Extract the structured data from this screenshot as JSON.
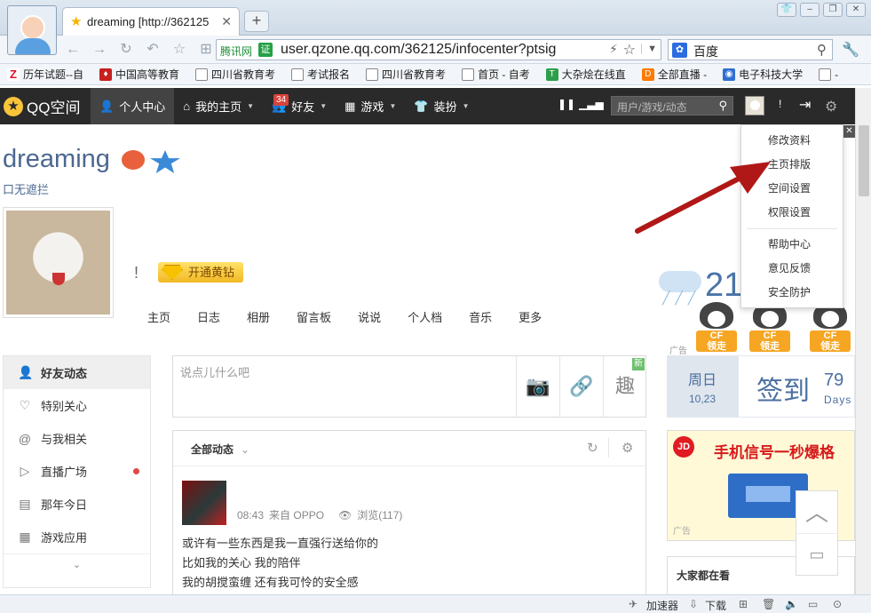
{
  "browser": {
    "tab_title": "dreaming [http://362125",
    "address": {
      "site_label": "腾讯网",
      "cert_label": "证",
      "url": "user.qzone.qq.com/362125/infocenter?ptsig"
    },
    "search": {
      "engine": "百度"
    },
    "bookmarks": [
      {
        "label": "历年试题--自",
        "icon": "z-icon"
      },
      {
        "label": "中国高等教育",
        "icon": "red-icon"
      },
      {
        "label": "四川省教育考",
        "icon": "doc-icon"
      },
      {
        "label": "考试报名",
        "icon": "doc-icon"
      },
      {
        "label": "四川省教育考",
        "icon": "doc-icon"
      },
      {
        "label": "首页 - 自考",
        "icon": "doc-icon"
      },
      {
        "label": "大杂烩在线直",
        "icon": "green-icon"
      },
      {
        "label": "全部直播 -",
        "icon": "orange-icon"
      },
      {
        "label": "电子科技大学",
        "icon": "blue-icon"
      },
      {
        "label": "-",
        "icon": "doc-icon"
      }
    ],
    "status": {
      "accelerator": "加速器",
      "download": "下载"
    }
  },
  "qzone_bar": {
    "logo": "QQ空间",
    "nav": [
      {
        "label": "个人中心",
        "active": true
      },
      {
        "label": "我的主页",
        "caret": true
      },
      {
        "label": "好友",
        "caret": true,
        "badge": "34"
      },
      {
        "label": "游戏",
        "caret": true
      },
      {
        "label": "装扮",
        "caret": true
      }
    ],
    "search_placeholder": "用户/游戏/动态",
    "exclaim": "!"
  },
  "profile": {
    "name": "dreaming",
    "signature": "口无遮拦",
    "exclaim": "!",
    "vip_button": "开通黄钻",
    "nav": [
      "主页",
      "日志",
      "相册",
      "留言板",
      "说说",
      "个人档",
      "音乐",
      "更多"
    ]
  },
  "weather": {
    "temp": "21",
    "ad_tag": "广告"
  },
  "dogs": [
    {
      "line1": "CF",
      "line2": "领走"
    },
    {
      "line1": "CF",
      "line2": "领走"
    },
    {
      "line1": "CF",
      "line2": "领走"
    }
  ],
  "left_menu": {
    "items": [
      {
        "label": "好友动态",
        "icon": "user-icon",
        "active": true
      },
      {
        "label": "特别关心",
        "icon": "heart-icon"
      },
      {
        "label": "与我相关",
        "icon": "at-icon"
      },
      {
        "label": "直播广场",
        "icon": "play-icon",
        "dot": true
      },
      {
        "label": "那年今日",
        "icon": "calendar-icon"
      },
      {
        "label": "游戏应用",
        "icon": "grid-icon"
      }
    ]
  },
  "composer": {
    "placeholder": "说点儿什么吧",
    "new_badge": "新",
    "fun_label": "趣"
  },
  "feed": {
    "filter": "全部动态",
    "post": {
      "name": "",
      "time": "08:43",
      "source": "来自 OPPO",
      "views": "浏览(117)",
      "lines": [
        "或许有一些东西是我一直强行送给你的",
        "比如我的关心 我的陪伴",
        "我的胡搅蛮缠 还有我可怜的安全感"
      ]
    }
  },
  "checkin": {
    "day_of_week": "周日",
    "date": "10,23",
    "label": "签到",
    "count": "79",
    "unit": "Days"
  },
  "ad": {
    "brand": "JD",
    "headline": "手机信号一秒爆格",
    "tag": "广告"
  },
  "hot": {
    "title": "大家都在看"
  },
  "dropdown": {
    "group1": [
      "修改资料",
      "主页排版",
      "空间设置",
      "权限设置"
    ],
    "group2": [
      "帮助中心",
      "意见反馈",
      "安全防护"
    ]
  },
  "colors": {
    "qq_bar": "#2a2a2a",
    "link_blue": "#4c6890",
    "arrow_red": "#b01818",
    "vip_gold": "#f2b824"
  }
}
